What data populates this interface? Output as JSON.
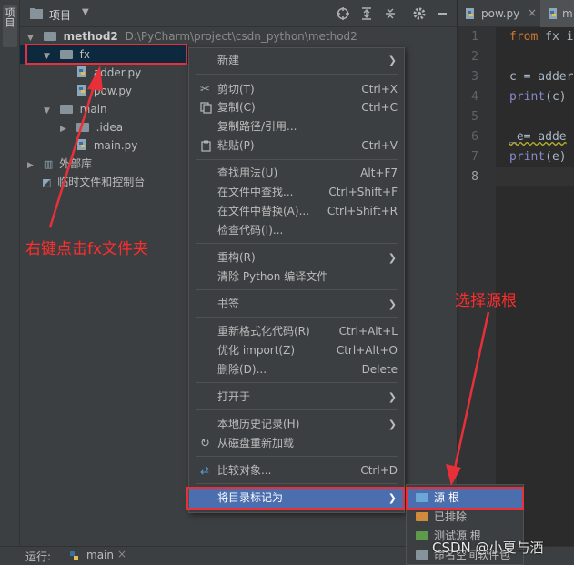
{
  "side_tab": "项目",
  "toolbar": {
    "title": "项目"
  },
  "tree": {
    "root_name": "method2",
    "root_path": "D:\\PyCharm\\project\\csdn_python\\method2",
    "fx": "fx",
    "adder": "adder.py",
    "pow": "pow.py",
    "main_folder": "main",
    "idea": ".idea",
    "main_py": "main.py",
    "external": "外部库",
    "scratch": "临时文件和控制台"
  },
  "editor": {
    "tab1": "pow.py",
    "tab2": "m",
    "line_numbers": [
      "1",
      "2",
      "3",
      "4",
      "5",
      "6",
      "7",
      "8"
    ],
    "lines": {
      "l1_kw": "from",
      "l1_rest": " fx i",
      "l3": "c = adder",
      "l4_fn": "print",
      "l4_rest": "(c)",
      "l6": "_e= adde",
      "l7_fn": "print",
      "l7_rest": "(e)"
    }
  },
  "run_bar": {
    "label": "运行:",
    "tab": "main"
  },
  "context_menu": {
    "new": "新建",
    "cut": "剪切(T)",
    "cut_sc": "Ctrl+X",
    "copy": "复制(C)",
    "copy_sc": "Ctrl+C",
    "copy_path": "复制路径/引用...",
    "paste": "粘贴(P)",
    "paste_sc": "Ctrl+V",
    "find_usages": "查找用法(U)",
    "find_usages_sc": "Alt+F7",
    "find_in_files": "在文件中查找...",
    "find_in_files_sc": "Ctrl+Shift+F",
    "replace_in_files": "在文件中替换(A)...",
    "replace_in_files_sc": "Ctrl+Shift+R",
    "inspect": "检查代码(I)...",
    "refactor": "重构(R)",
    "clean_python": "清除 Python 编译文件",
    "bookmarks": "书签",
    "reformat": "重新格式化代码(R)",
    "reformat_sc": "Ctrl+Alt+L",
    "optimize_imports": "优化 import(Z)",
    "optimize_imports_sc": "Ctrl+Alt+O",
    "delete": "删除(D)...",
    "delete_sc": "Delete",
    "open_in": "打开于",
    "local_history": "本地历史记录(H)",
    "reload": "从磁盘重新加载",
    "compare": "比较对象...",
    "compare_sc": "Ctrl+D",
    "mark_dir": "将目录标记为"
  },
  "submenu": {
    "sources_root": "源 根",
    "excluded": "已排除",
    "test_sources_root": "测试源 根",
    "namespace_pkg": "命名空间软件包"
  },
  "annotations": {
    "right_click": "右键点击fx文件夹",
    "choose_root": "选择源根"
  },
  "watermark": "CSDN @小夏与酒",
  "colors": {
    "selection": "#4b6eaf",
    "annotation_red": "#e8303a",
    "folder_blue": "#6aa6d6"
  }
}
